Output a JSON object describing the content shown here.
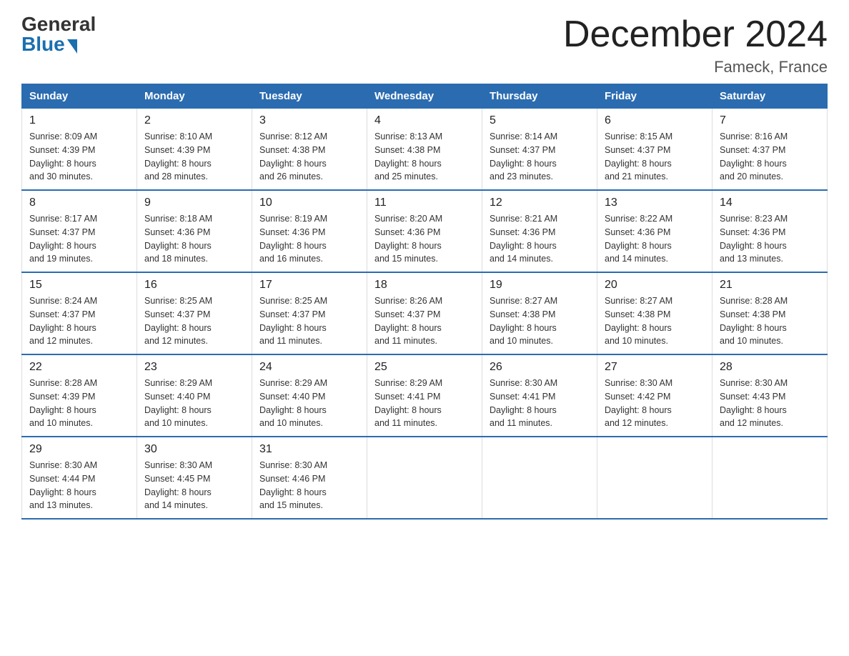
{
  "logo": {
    "general": "General",
    "blue": "Blue"
  },
  "title": "December 2024",
  "location": "Fameck, France",
  "days_of_week": [
    "Sunday",
    "Monday",
    "Tuesday",
    "Wednesday",
    "Thursday",
    "Friday",
    "Saturday"
  ],
  "weeks": [
    [
      {
        "day": "1",
        "sunrise": "8:09 AM",
        "sunset": "4:39 PM",
        "daylight": "8 hours and 30 minutes."
      },
      {
        "day": "2",
        "sunrise": "8:10 AM",
        "sunset": "4:39 PM",
        "daylight": "8 hours and 28 minutes."
      },
      {
        "day": "3",
        "sunrise": "8:12 AM",
        "sunset": "4:38 PM",
        "daylight": "8 hours and 26 minutes."
      },
      {
        "day": "4",
        "sunrise": "8:13 AM",
        "sunset": "4:38 PM",
        "daylight": "8 hours and 25 minutes."
      },
      {
        "day": "5",
        "sunrise": "8:14 AM",
        "sunset": "4:37 PM",
        "daylight": "8 hours and 23 minutes."
      },
      {
        "day": "6",
        "sunrise": "8:15 AM",
        "sunset": "4:37 PM",
        "daylight": "8 hours and 21 minutes."
      },
      {
        "day": "7",
        "sunrise": "8:16 AM",
        "sunset": "4:37 PM",
        "daylight": "8 hours and 20 minutes."
      }
    ],
    [
      {
        "day": "8",
        "sunrise": "8:17 AM",
        "sunset": "4:37 PM",
        "daylight": "8 hours and 19 minutes."
      },
      {
        "day": "9",
        "sunrise": "8:18 AM",
        "sunset": "4:36 PM",
        "daylight": "8 hours and 18 minutes."
      },
      {
        "day": "10",
        "sunrise": "8:19 AM",
        "sunset": "4:36 PM",
        "daylight": "8 hours and 16 minutes."
      },
      {
        "day": "11",
        "sunrise": "8:20 AM",
        "sunset": "4:36 PM",
        "daylight": "8 hours and 15 minutes."
      },
      {
        "day": "12",
        "sunrise": "8:21 AM",
        "sunset": "4:36 PM",
        "daylight": "8 hours and 14 minutes."
      },
      {
        "day": "13",
        "sunrise": "8:22 AM",
        "sunset": "4:36 PM",
        "daylight": "8 hours and 14 minutes."
      },
      {
        "day": "14",
        "sunrise": "8:23 AM",
        "sunset": "4:36 PM",
        "daylight": "8 hours and 13 minutes."
      }
    ],
    [
      {
        "day": "15",
        "sunrise": "8:24 AM",
        "sunset": "4:37 PM",
        "daylight": "8 hours and 12 minutes."
      },
      {
        "day": "16",
        "sunrise": "8:25 AM",
        "sunset": "4:37 PM",
        "daylight": "8 hours and 12 minutes."
      },
      {
        "day": "17",
        "sunrise": "8:25 AM",
        "sunset": "4:37 PM",
        "daylight": "8 hours and 11 minutes."
      },
      {
        "day": "18",
        "sunrise": "8:26 AM",
        "sunset": "4:37 PM",
        "daylight": "8 hours and 11 minutes."
      },
      {
        "day": "19",
        "sunrise": "8:27 AM",
        "sunset": "4:38 PM",
        "daylight": "8 hours and 10 minutes."
      },
      {
        "day": "20",
        "sunrise": "8:27 AM",
        "sunset": "4:38 PM",
        "daylight": "8 hours and 10 minutes."
      },
      {
        "day": "21",
        "sunrise": "8:28 AM",
        "sunset": "4:38 PM",
        "daylight": "8 hours and 10 minutes."
      }
    ],
    [
      {
        "day": "22",
        "sunrise": "8:28 AM",
        "sunset": "4:39 PM",
        "daylight": "8 hours and 10 minutes."
      },
      {
        "day": "23",
        "sunrise": "8:29 AM",
        "sunset": "4:40 PM",
        "daylight": "8 hours and 10 minutes."
      },
      {
        "day": "24",
        "sunrise": "8:29 AM",
        "sunset": "4:40 PM",
        "daylight": "8 hours and 10 minutes."
      },
      {
        "day": "25",
        "sunrise": "8:29 AM",
        "sunset": "4:41 PM",
        "daylight": "8 hours and 11 minutes."
      },
      {
        "day": "26",
        "sunrise": "8:30 AM",
        "sunset": "4:41 PM",
        "daylight": "8 hours and 11 minutes."
      },
      {
        "day": "27",
        "sunrise": "8:30 AM",
        "sunset": "4:42 PM",
        "daylight": "8 hours and 12 minutes."
      },
      {
        "day": "28",
        "sunrise": "8:30 AM",
        "sunset": "4:43 PM",
        "daylight": "8 hours and 12 minutes."
      }
    ],
    [
      {
        "day": "29",
        "sunrise": "8:30 AM",
        "sunset": "4:44 PM",
        "daylight": "8 hours and 13 minutes."
      },
      {
        "day": "30",
        "sunrise": "8:30 AM",
        "sunset": "4:45 PM",
        "daylight": "8 hours and 14 minutes."
      },
      {
        "day": "31",
        "sunrise": "8:30 AM",
        "sunset": "4:46 PM",
        "daylight": "8 hours and 15 minutes."
      },
      null,
      null,
      null,
      null
    ]
  ],
  "labels": {
    "sunrise_prefix": "Sunrise: ",
    "sunset_prefix": "Sunset: ",
    "daylight_prefix": "Daylight: "
  }
}
